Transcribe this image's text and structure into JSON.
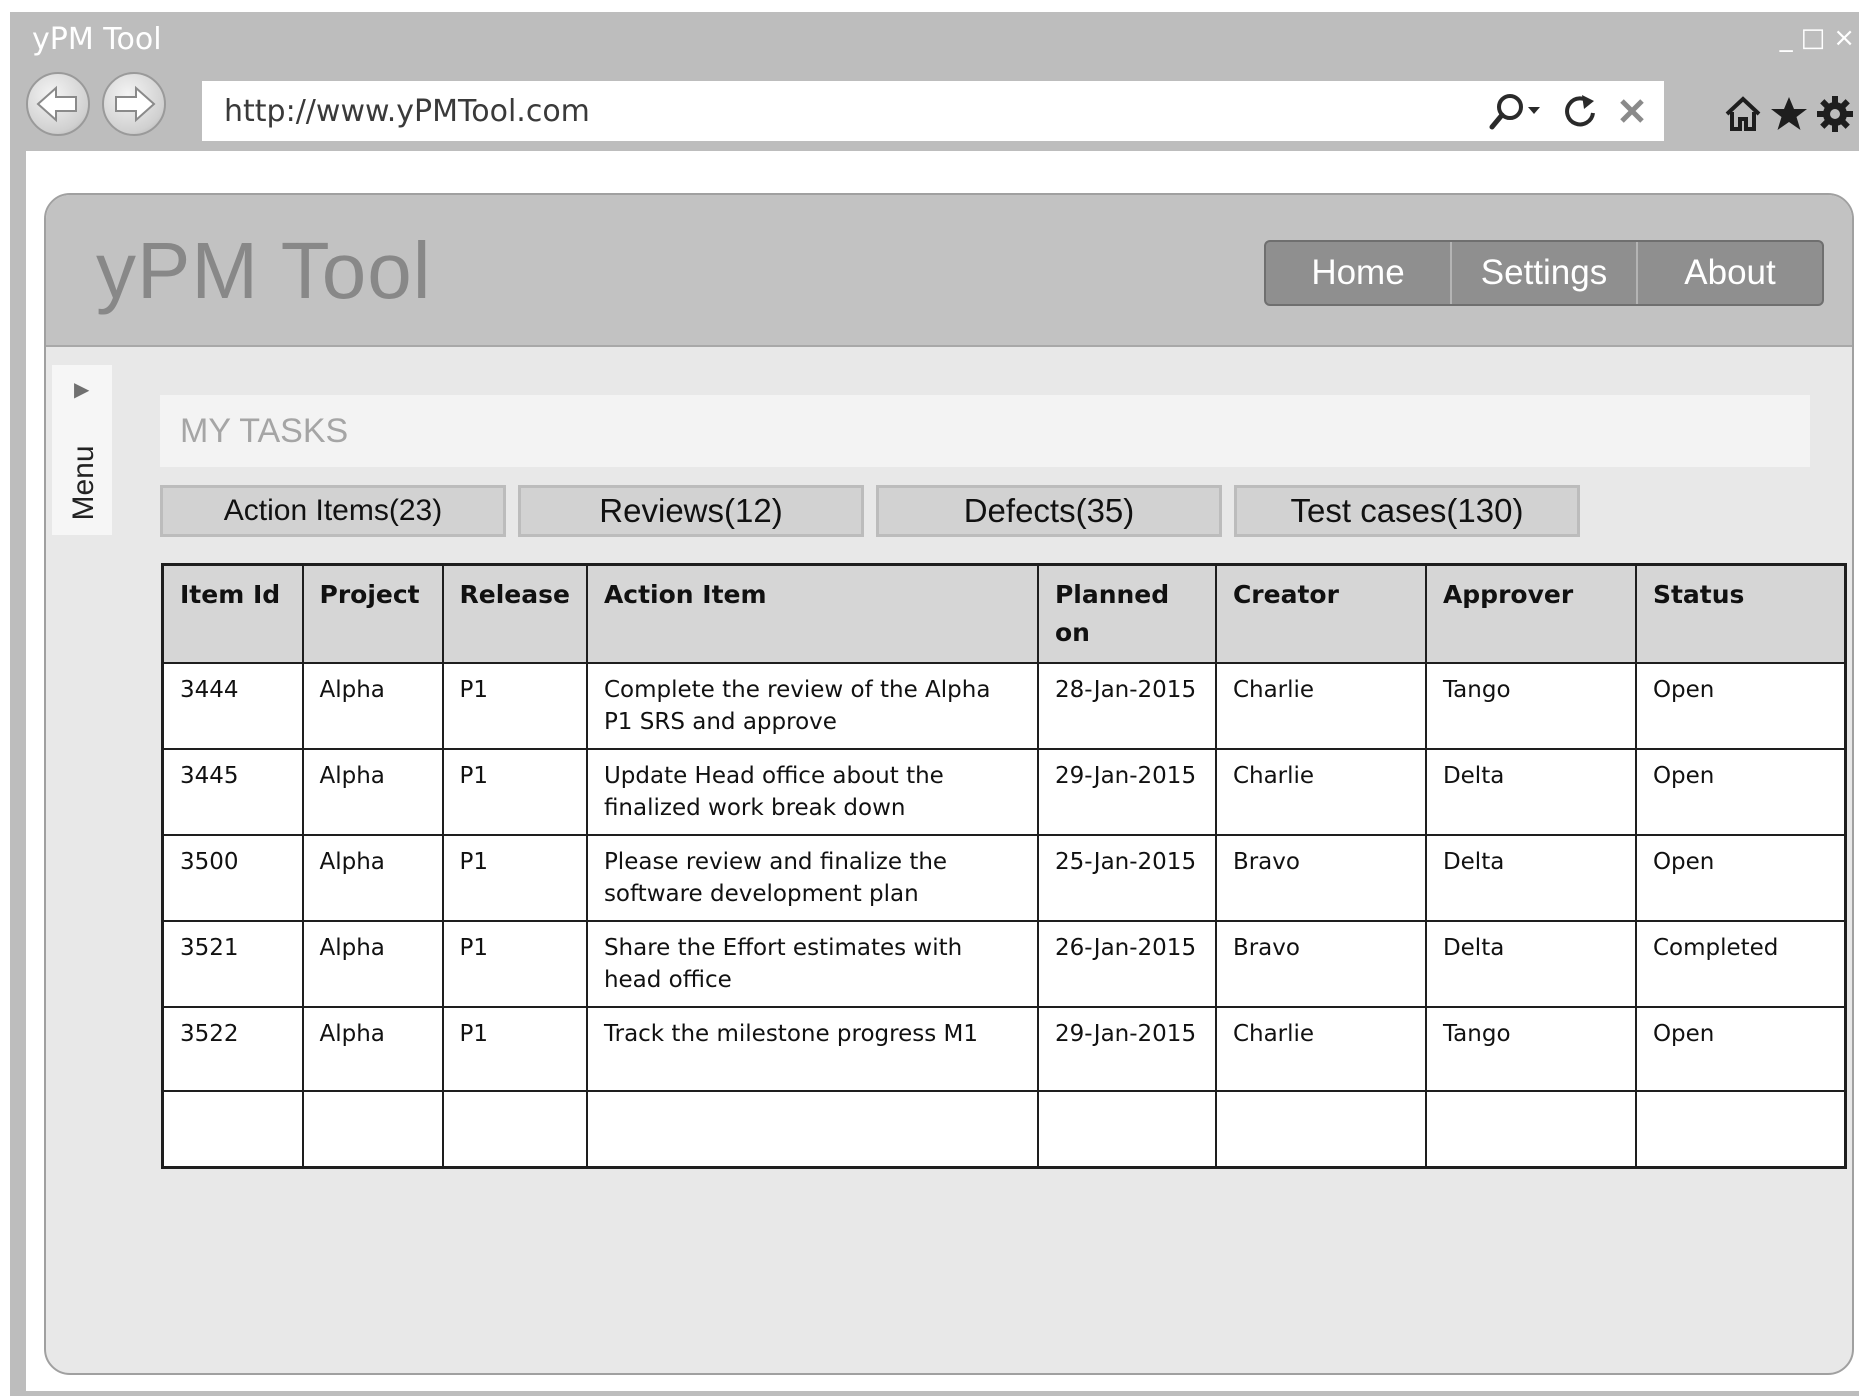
{
  "browser": {
    "window_title": "yPM Tool",
    "url": "http://www.yPMTool.com",
    "controls": {
      "minimize": "_",
      "maximize": "□",
      "close": "×"
    },
    "icons": [
      "back-icon",
      "forward-icon",
      "search-icon",
      "refresh-icon",
      "stop-icon",
      "home-icon",
      "star-icon",
      "gear-icon"
    ]
  },
  "app": {
    "title": "yPM Tool",
    "nav": [
      "Home",
      "Settings",
      "About"
    ],
    "side_menu_label": "Menu",
    "section_title": "MY TASKS",
    "tabs": [
      "Action Items(23)",
      "Reviews(12)",
      "Defects(35)",
      "Test cases(130)"
    ]
  },
  "table": {
    "columns": [
      "Item Id",
      "Project",
      "Release",
      "Action Item",
      "Planned on",
      "Creator",
      "Approver",
      "Status"
    ],
    "rows": [
      [
        "3444",
        "Alpha",
        "P1",
        "Complete the review of the Alpha P1 SRS and approve",
        "28-Jan-2015",
        "Charlie",
        "Tango",
        "Open"
      ],
      [
        "3445",
        "Alpha",
        "P1",
        "Update Head office about the finalized work break down",
        "29-Jan-2015",
        "Charlie",
        "Delta",
        "Open"
      ],
      [
        "3500",
        "Alpha",
        "P1",
        "Please review and finalize the software development plan",
        "25-Jan-2015",
        "Bravo",
        "Delta",
        "Open"
      ],
      [
        "3521",
        "Alpha",
        "P1",
        "Share the Effort estimates with head office",
        "26-Jan-2015",
        "Bravo",
        "Delta",
        "Completed"
      ],
      [
        "3522",
        "Alpha",
        "P1",
        "Track the milestone progress M1",
        "29-Jan-2015",
        "Charlie",
        "Tango",
        "Open"
      ],
      [
        "",
        "",
        "",
        "",
        "",
        "",
        "",
        ""
      ]
    ]
  }
}
